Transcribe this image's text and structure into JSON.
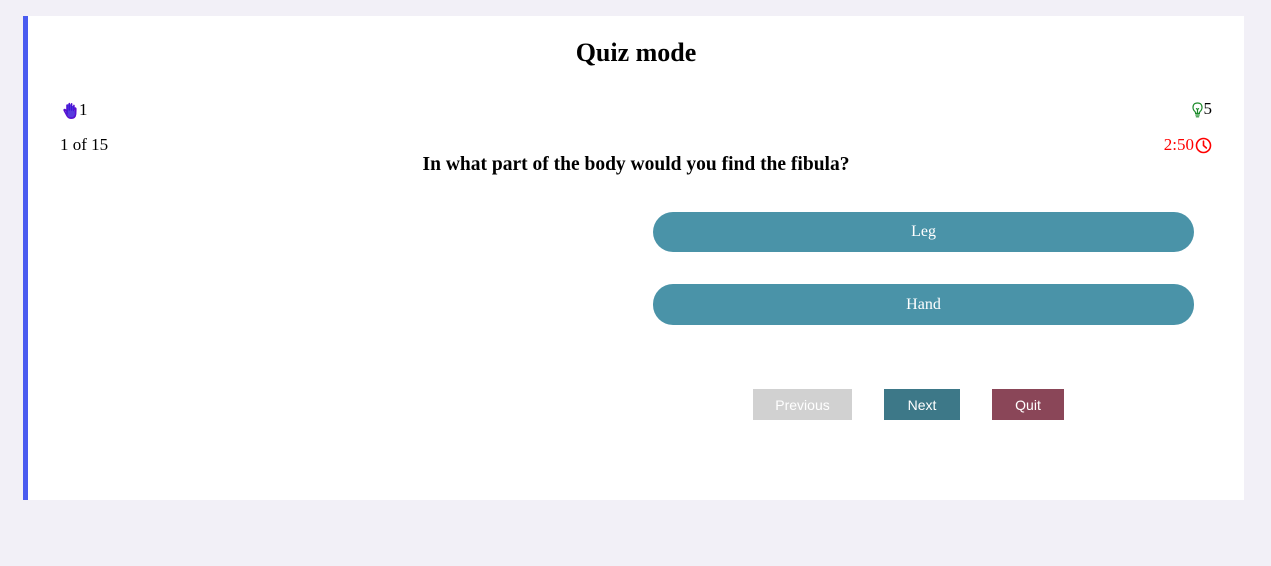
{
  "header": {
    "title": "Quiz mode"
  },
  "stats": {
    "lifelines": "1",
    "lifeline_icon": "raised-hand-icon",
    "hints": "5",
    "hint_icon": "lightbulb-icon",
    "progress": "1 of 15",
    "timer": "2:50",
    "timer_icon": "clock-icon",
    "timer_color": "#ff0000"
  },
  "question": {
    "text": "In what part of the body would you find the fibula?",
    "options": [
      {
        "label": "Leg"
      },
      {
        "label": "Hand"
      }
    ]
  },
  "nav": {
    "previous_label": "Previous",
    "next_label": "Next",
    "quit_label": "Quit"
  },
  "colors": {
    "accent": "#4a5cf0",
    "option_bg": "#4a93a8",
    "next_bg": "#3d7888",
    "quit_bg": "#8a4658",
    "previous_bg": "#d1d1d1"
  }
}
